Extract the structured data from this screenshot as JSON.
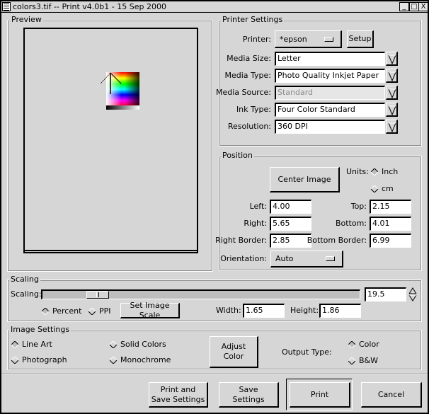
{
  "window": {
    "title": "colors3.tif -- Print v4.0b1 - 15 Sep 2000",
    "minimize_glyph": "_",
    "maximize_glyph": "□",
    "close_glyph": "X"
  },
  "preview": {
    "title": "Preview"
  },
  "printer_settings": {
    "title": "Printer Settings",
    "printer_label": "Printer:",
    "printer_value": "*epson",
    "setup_label": "Setup",
    "media_size_label": "Media Size:",
    "media_size_value": "Letter",
    "media_type_label": "Media Type:",
    "media_type_value": "Photo Quality Inkjet Paper",
    "media_source_label": "Media Source:",
    "media_source_value": "Standard",
    "ink_type_label": "Ink Type:",
    "ink_type_value": "Four Color Standard",
    "resolution_label": "Resolution:",
    "resolution_value": "360 DPI"
  },
  "position": {
    "title": "Position",
    "center_image_label": "Center Image",
    "units_label": "Units:",
    "units_options": [
      {
        "label": "Inch",
        "selected": true
      },
      {
        "label": "cm",
        "selected": false
      }
    ],
    "left_label": "Left:",
    "left_value": "4.00",
    "top_label": "Top:",
    "top_value": "2.15",
    "right_label": "Right:",
    "right_value": "5.65",
    "bottom_label": "Bottom:",
    "bottom_value": "4.01",
    "right_border_label": "Right Border:",
    "right_border_value": "2.85",
    "bottom_border_label": "Bottom Border:",
    "bottom_border_value": "6.99",
    "orientation_label": "Orientation:",
    "orientation_value": "Auto"
  },
  "scaling": {
    "title": "Scaling",
    "scaling_label": "Scaling:",
    "scaling_value": "19.5",
    "slider_fraction": 0.15,
    "mode_options": [
      {
        "label": "Percent",
        "selected": true
      },
      {
        "label": "PPI",
        "selected": false
      }
    ],
    "set_image_scale_label": "Set Image Scale",
    "width_label": "Width:",
    "width_value": "1.65",
    "height_label": "Height:",
    "height_value": "1.86"
  },
  "image_settings": {
    "title": "Image Settings",
    "image_type_options": [
      {
        "label": "Line Art",
        "selected": true
      },
      {
        "label": "Solid Colors",
        "selected": false
      },
      {
        "label": "Photograph",
        "selected": false
      },
      {
        "label": "Monochrome",
        "selected": false
      }
    ],
    "adjust_color_label": "Adjust Color",
    "output_type_label": "Output Type:",
    "output_type_options": [
      {
        "label": "Color",
        "selected": true
      },
      {
        "label": "B&W",
        "selected": false
      }
    ]
  },
  "actions": {
    "print_and_save_line1": "Print and",
    "print_and_save_line2": "Save Settings",
    "save_settings_line1": "Save",
    "save_settings_line2": "Settings",
    "print_label": "Print",
    "cancel_label": "Cancel"
  }
}
